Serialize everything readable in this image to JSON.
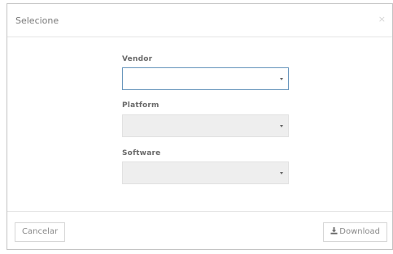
{
  "modal": {
    "title": "Selecione",
    "close_glyph": "×"
  },
  "form": {
    "fields": [
      {
        "label": "Vendor",
        "value": "",
        "state": "focused"
      },
      {
        "label": "Platform",
        "value": "",
        "state": "disabled"
      },
      {
        "label": "Software",
        "value": "",
        "state": "disabled"
      }
    ]
  },
  "footer": {
    "cancel_label": "Cancelar",
    "download_label": "Download",
    "download_icon": "download-icon"
  },
  "colors": {
    "focus_border": "#6a97bd",
    "disabled_bg": "#eeeeee",
    "text_muted": "#8a8a8a"
  }
}
